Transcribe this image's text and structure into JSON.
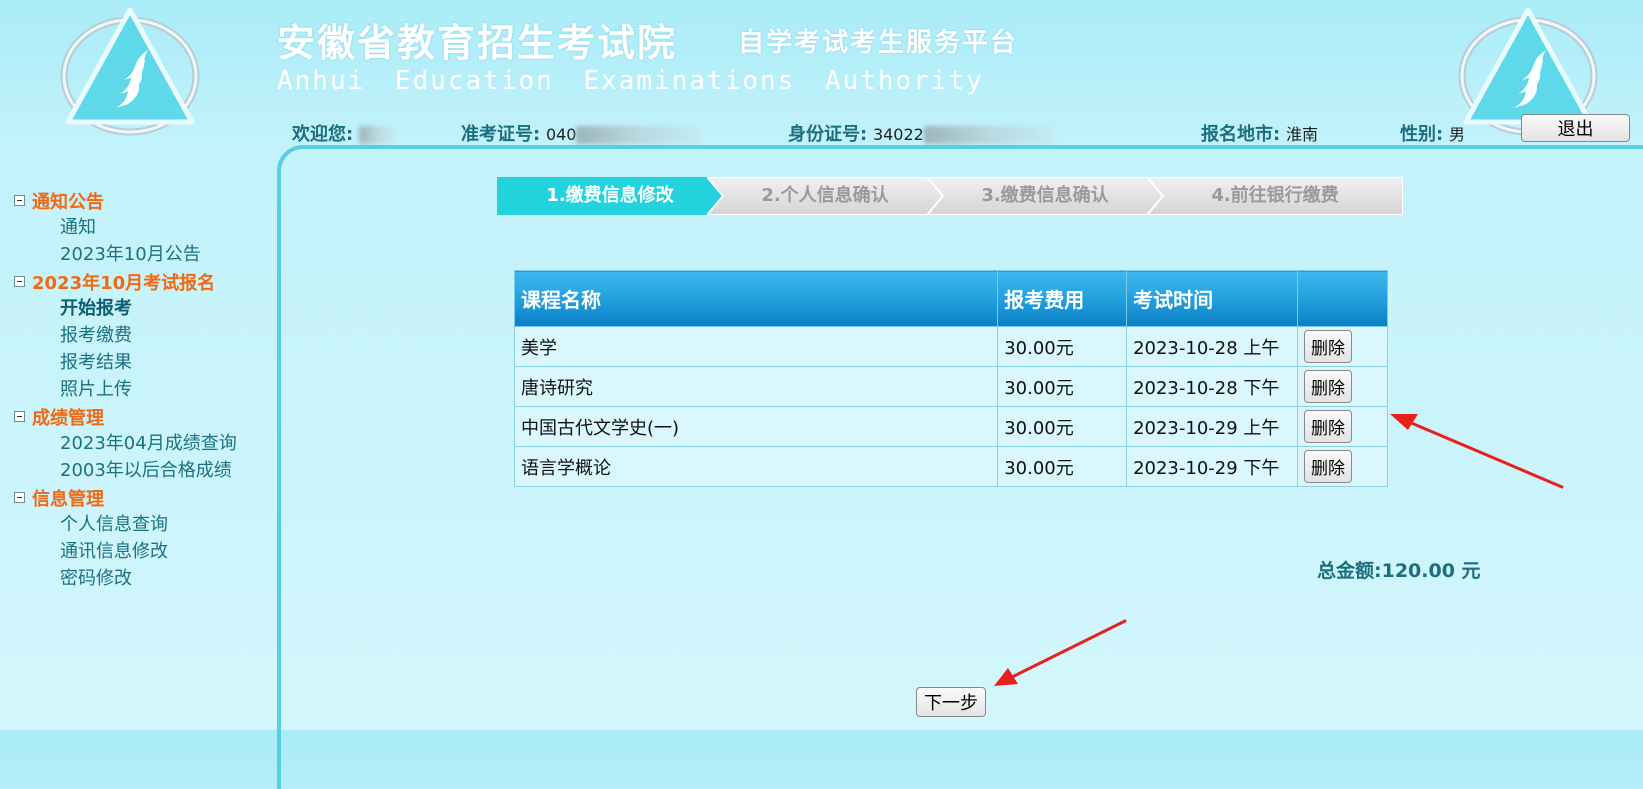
{
  "header": {
    "title_cn": "安徽省教育招生考试院",
    "subtitle": "自学考试考生服务平台",
    "title_en": "Anhui Education Examinations Authority"
  },
  "info": {
    "welcome_label": "欢迎您:",
    "exam_no_label": "准考证号:",
    "exam_no_value": "040",
    "id_label": "身份证号:",
    "id_value": "34022",
    "city_label": "报名地市:",
    "city_value": "淮南",
    "gender_label": "性别:",
    "gender_value": "男",
    "logout_label": "退出"
  },
  "sidebar": [
    {
      "title": "通知公告",
      "items": [
        "通知",
        "2023年10月公告"
      ]
    },
    {
      "title": "2023年10月考试报名",
      "items": [
        "开始报考",
        "报考缴费",
        "报考结果",
        "照片上传"
      ]
    },
    {
      "title": "成绩管理",
      "items": [
        "2023年04月成绩查询",
        "2003年以后合格成绩"
      ]
    },
    {
      "title": "信息管理",
      "items": [
        "个人信息查询",
        "通讯信息修改",
        "密码修改"
      ]
    }
  ],
  "steps": [
    "1.缴费信息修改",
    "2.个人信息确认",
    "3.缴费信息确认",
    "4.前往银行缴费"
  ],
  "table": {
    "headers": [
      "课程名称",
      "报考费用",
      "考试时间",
      ""
    ],
    "rows": [
      {
        "name": "美学",
        "fee": "30.00元",
        "time": "2023-10-28 上午"
      },
      {
        "name": "唐诗研究",
        "fee": "30.00元",
        "time": "2023-10-28 下午"
      },
      {
        "name": "中国古代文学史(一)",
        "fee": "30.00元",
        "time": "2023-10-29 上午"
      },
      {
        "name": "语言学概论",
        "fee": "30.00元",
        "time": "2023-10-29 下午"
      }
    ],
    "delete_label": "删除"
  },
  "total": {
    "label": "总金额:",
    "value": "120.00 元"
  },
  "next_label": "下一步",
  "colors": {
    "accent": "#57cfe3",
    "section_title": "#f06a14",
    "nav_item": "#1b7280",
    "step_active": "#22d3dd",
    "annotation_arrow": "#e8201c"
  }
}
